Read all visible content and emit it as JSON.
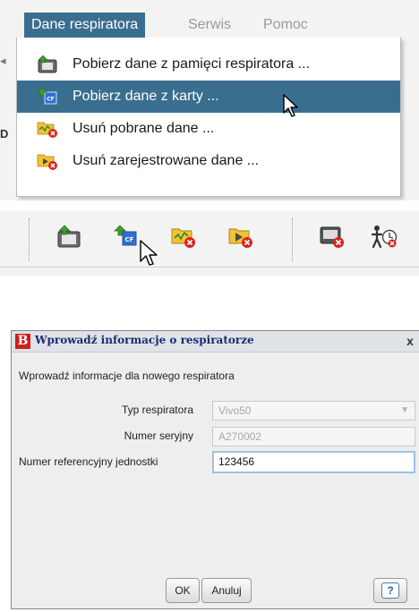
{
  "menubar": {
    "items": [
      {
        "label": "Dane respiratora",
        "active": true
      },
      {
        "label": "Serwis",
        "active": false
      },
      {
        "label": "Pomoc",
        "active": false
      }
    ]
  },
  "menu": {
    "items": [
      {
        "label": "Pobierz dane z pamięci respiratora ...",
        "icon": "download-from-ventilator-icon",
        "highlighted": false
      },
      {
        "label": "Pobierz dane z karty ...",
        "icon": "download-from-card-icon",
        "highlighted": true
      },
      {
        "label": "Usuń pobrane dane ...",
        "icon": "delete-downloaded-data-icon",
        "highlighted": false
      },
      {
        "label": "Usuń zarejestrowane dane ...",
        "icon": "delete-recorded-data-icon",
        "highlighted": false
      }
    ]
  },
  "toolbar": {
    "buttons": [
      "download-from-ventilator-icon",
      "download-from-card-icon",
      "delete-downloaded-data-icon",
      "delete-recorded-data-icon",
      "delete-device-icon",
      "patient-time-icon"
    ]
  },
  "dialog": {
    "logo": "B",
    "title": "Wprowadź informacje o respiratorze",
    "close": "x",
    "intro": "Wprowadź informacje dla nowego respiratora",
    "fields": {
      "type": {
        "label": "Typ respiratora",
        "value": "Vivo50"
      },
      "serial": {
        "label": "Numer seryjny",
        "value": "A270002"
      },
      "ref": {
        "label": "Numer referencyjny jednostki",
        "value": "123456"
      }
    },
    "buttons": {
      "ok": "OK",
      "cancel": "Anuluj",
      "help": "?"
    }
  },
  "colors": {
    "menu_highlight": "#3a6e8f",
    "dialog_title_text": "#1c2b6e",
    "logo_red": "#d11c1c",
    "delete_badge": "#d9241c",
    "active_field_border": "#9cc1e2"
  }
}
